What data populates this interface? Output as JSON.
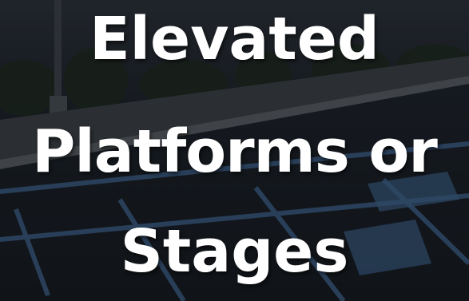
{
  "slide": {
    "title_lines": [
      "Elevated",
      "Platforms or",
      "Stages"
    ]
  },
  "colors": {
    "title_text": "#ffffff",
    "pavement": "#1b2129",
    "parking_lines": "#3d5f86"
  }
}
